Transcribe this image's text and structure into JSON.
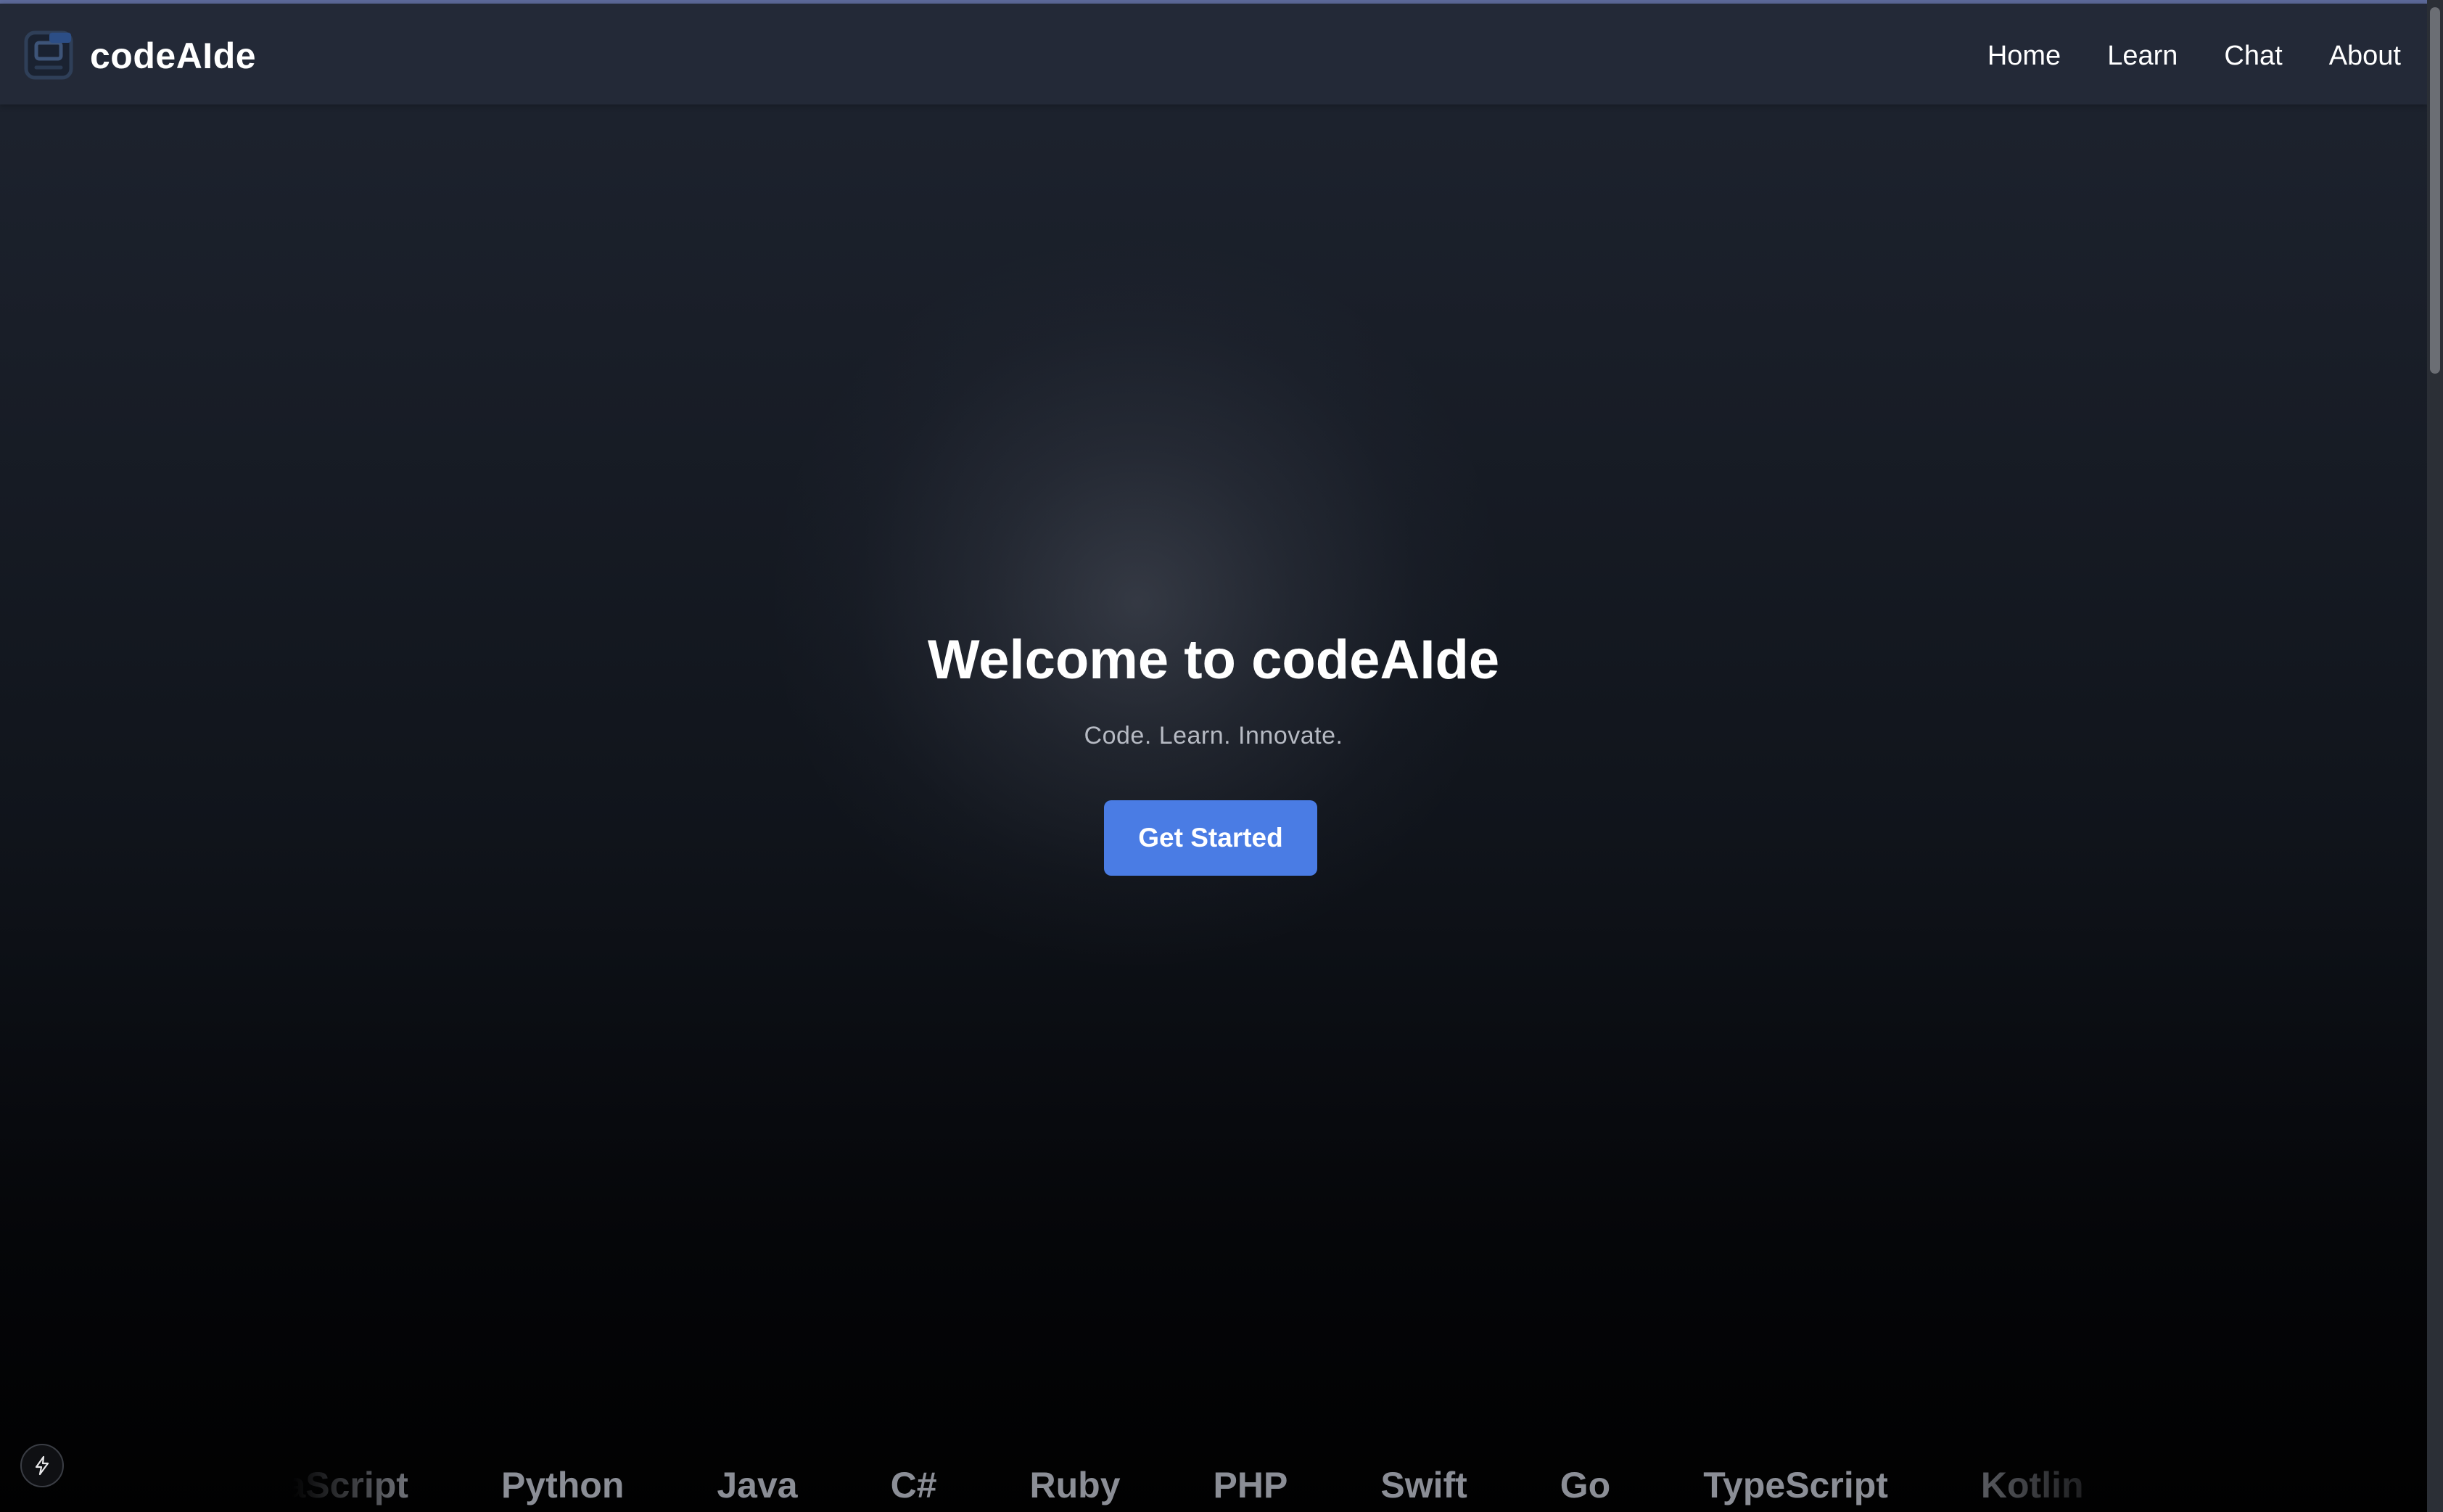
{
  "brand": {
    "name": "codeAIde",
    "logo_icon": "code-window-icon"
  },
  "nav": {
    "items": [
      {
        "label": "Home"
      },
      {
        "label": "Learn"
      },
      {
        "label": "Chat"
      },
      {
        "label": "About"
      }
    ]
  },
  "hero": {
    "title": "Welcome to codeAIde",
    "subtitle": "Code. Learn. Innovate.",
    "cta_label": "Get Started"
  },
  "languages": [
    "JavaScript",
    "Python",
    "Java",
    "C#",
    "Ruby",
    "PHP",
    "Swift",
    "Go",
    "TypeScript",
    "Kotlin"
  ],
  "floating_button": {
    "icon": "lightning-bolt-icon"
  },
  "colors": {
    "navbar_bg": "#232937",
    "accent": "#4a7ce4",
    "text_primary": "#ffffff",
    "text_muted": "#b6bac3",
    "language_text": "#8b8e96"
  }
}
